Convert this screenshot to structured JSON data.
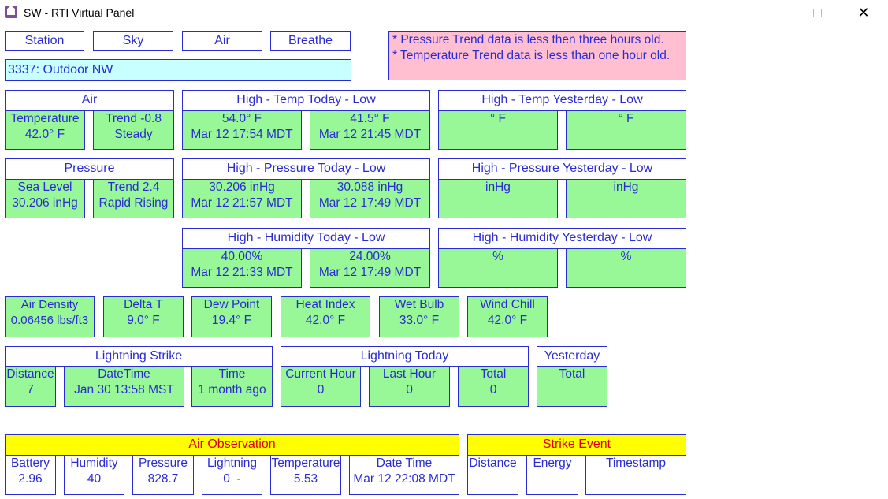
{
  "window": {
    "title": "SW - RTI Virtual Panel",
    "close": "✕"
  },
  "nav": {
    "station": "Station",
    "sky": "Sky",
    "air": "Air",
    "breathe": "Breathe"
  },
  "device": "3337: Outdoor NW",
  "notice": {
    "line1": "* Pressure Trend data is less then three hours old.",
    "line2": "* Temperature Trend data is less than one hour old."
  },
  "air": {
    "header": "Air",
    "temperature": {
      "label": "Temperature",
      "value": "42.0° F"
    },
    "trend": {
      "label": "Trend -0.8",
      "value": "Steady"
    }
  },
  "temp_today": {
    "header": "High - Temp Today - Low",
    "high": {
      "value": "54.0° F",
      "time": "Mar 12 17:54 MDT"
    },
    "low": {
      "value": "41.5° F",
      "time": "Mar 12 21:45 MDT"
    }
  },
  "temp_yesterday": {
    "header": "High - Temp Yesterday - Low",
    "high": {
      "value": "° F"
    },
    "low": {
      "value": "° F"
    }
  },
  "pressure": {
    "header": "Pressure",
    "sea_level": {
      "label": "Sea Level",
      "value": "30.206 inHg"
    },
    "trend": {
      "label": "Trend 2.4",
      "value": "Rapid Rising"
    }
  },
  "pressure_today": {
    "header": "High - Pressure Today - Low",
    "high": {
      "value": "30.206 inHg",
      "time": "Mar 12 21:57 MDT"
    },
    "low": {
      "value": "30.088 inHg",
      "time": "Mar 12 17:49 MDT"
    }
  },
  "pressure_yesterday": {
    "header": "High - Pressure Yesterday - Low",
    "high": {
      "value": "inHg"
    },
    "low": {
      "value": "inHg"
    }
  },
  "humidity_today": {
    "header": "High - Humidity Today - Low",
    "high": {
      "value": "40.00%",
      "time": "Mar 12 21:33 MDT"
    },
    "low": {
      "value": "24.00%",
      "time": "Mar 12 17:49 MDT"
    }
  },
  "humidity_yesterday": {
    "header": "High - Humidity Yesterday - Low",
    "high": {
      "value": "%"
    },
    "low": {
      "value": "%"
    }
  },
  "derived": [
    {
      "label": "Air Density",
      "value": "0.06456 lbs/ft3"
    },
    {
      "label": "Delta T",
      "value": "9.0° F"
    },
    {
      "label": "Dew Point",
      "value": "19.4° F"
    },
    {
      "label": "Heat Index",
      "value": "42.0° F"
    },
    {
      "label": "Wet Bulb",
      "value": "33.0° F"
    },
    {
      "label": "Wind Chill",
      "value": "42.0° F"
    }
  ],
  "lightning_strike": {
    "header": "Lightning Strike",
    "distance": {
      "label": "Distance",
      "value": "7"
    },
    "datetime": {
      "label": "DateTime",
      "value": "Jan 30 13:58 MST"
    },
    "time": {
      "label": "Time",
      "value": "1 month ago"
    }
  },
  "lightning_today": {
    "header": "Lightning Today",
    "current_hour": {
      "label": "Current Hour",
      "value": "0"
    },
    "last_hour": {
      "label": "Last Hour",
      "value": "0"
    },
    "total": {
      "label": "Total",
      "value": "0"
    }
  },
  "lightning_yesterday": {
    "header": "Yesterday",
    "total": {
      "label": "Total"
    }
  },
  "air_observation": {
    "header": "Air Observation",
    "battery": {
      "label": "Battery",
      "value": "2.96"
    },
    "humidity": {
      "label": "Humidity",
      "value": "40"
    },
    "pressure": {
      "label": "Pressure",
      "value": "828.7"
    },
    "lightning": {
      "label": "Lightning",
      "value": "0  -"
    },
    "temperature": {
      "label": "Temperature",
      "value": "5.53"
    },
    "datetime": {
      "label": "Date Time",
      "value": "Mar 12 22:08 MDT"
    }
  },
  "strike_event": {
    "header": "Strike Event",
    "distance": {
      "label": "Distance"
    },
    "energy": {
      "label": "Energy"
    },
    "timestamp": {
      "label": "Timestamp"
    }
  },
  "colors": {
    "border_text": "#2b2bd4",
    "green_cell": "#98f898",
    "yellow_header": "#ffff00",
    "header_red_text": "#e00000",
    "notice_pink": "#ffbfd0",
    "device_cyan": "#c8ffff"
  }
}
